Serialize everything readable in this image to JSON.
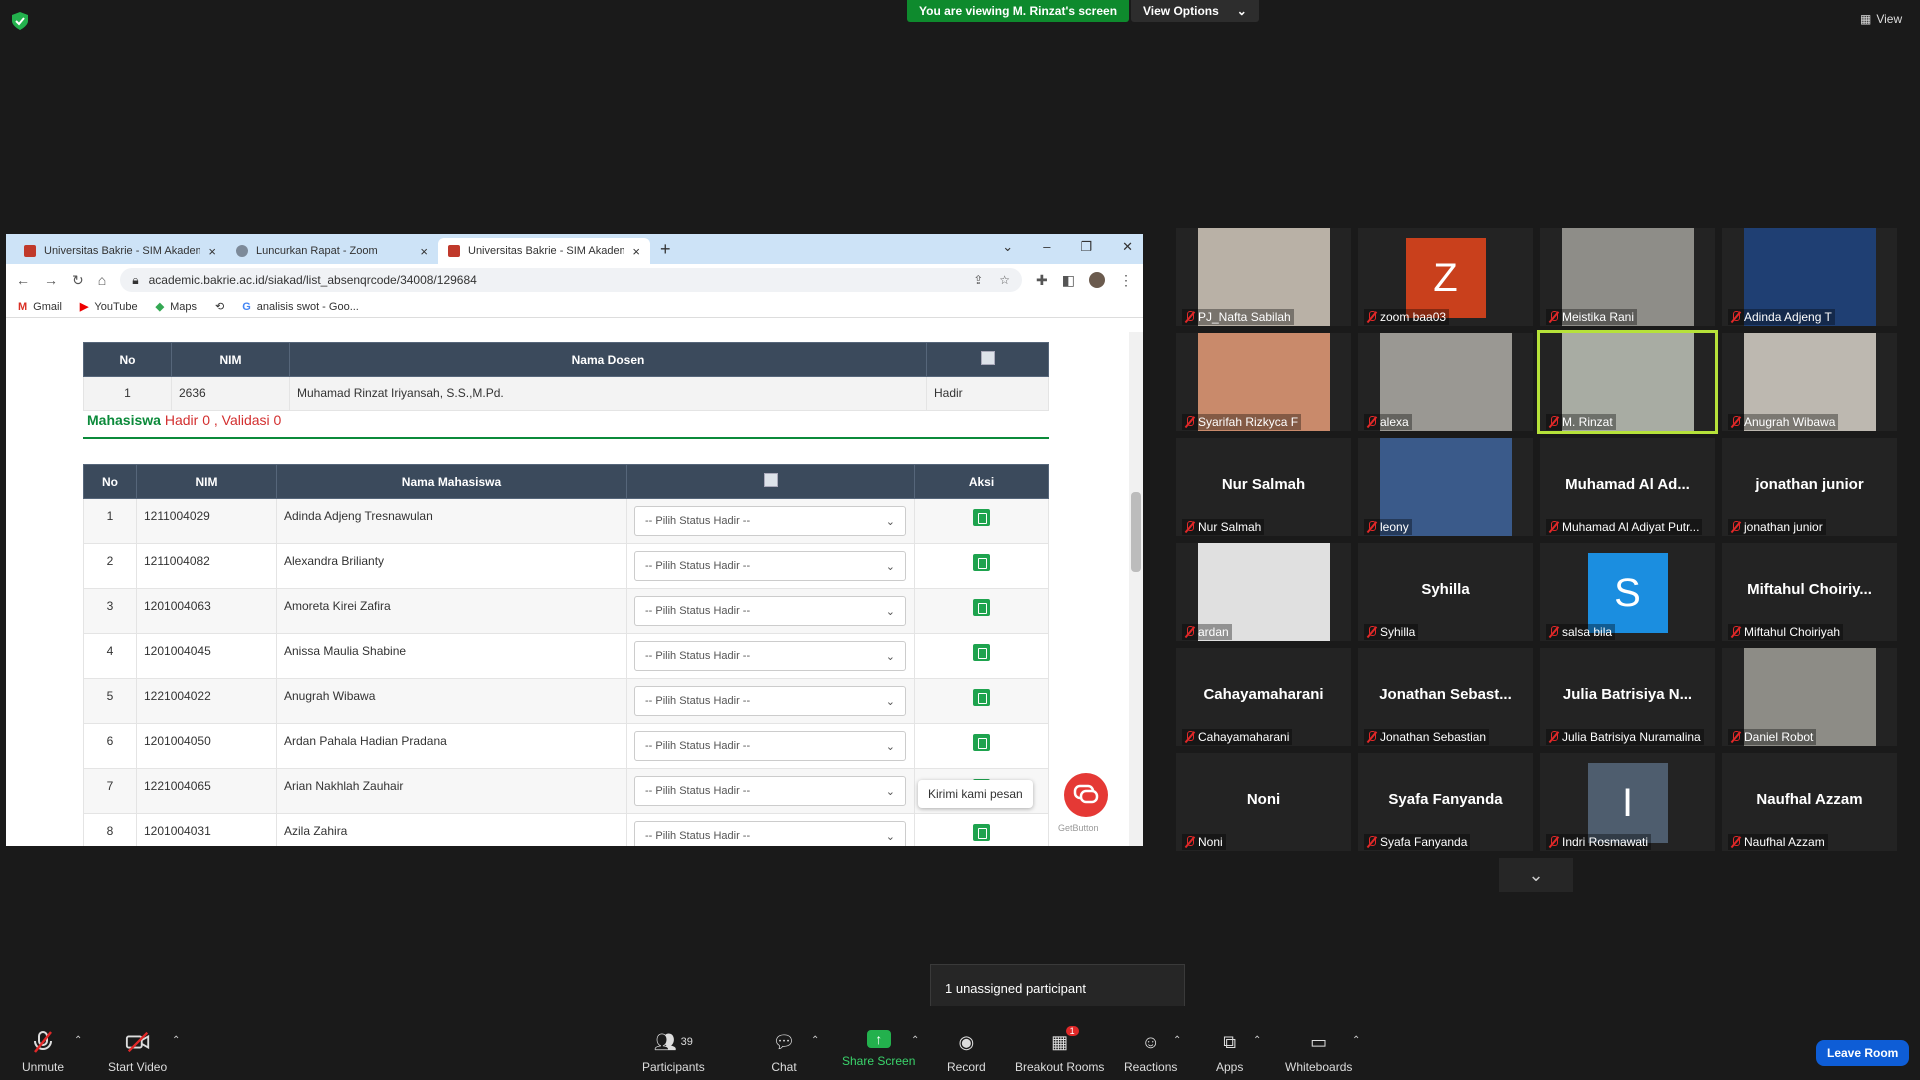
{
  "zoom_top": {
    "viewing_text": "You are viewing M. Rinzat's screen",
    "view_options": "View Options",
    "view_label": "View"
  },
  "browser": {
    "tabs": [
      {
        "title": "Universitas Bakrie - SIM Akadem",
        "active": false
      },
      {
        "title": "Luncurkan Rapat - Zoom",
        "active": false
      },
      {
        "title": "Universitas Bakrie - SIM Akadem",
        "active": true
      }
    ],
    "url": "academic.bakrie.ac.id/siakad/list_absenqrcode/34008/129684",
    "bookmarks": [
      "Gmail",
      "YouTube",
      "Maps",
      "analisis swot - Goo..."
    ]
  },
  "dosen_table": {
    "headers": [
      "No",
      "NIM",
      "Nama Dosen"
    ],
    "rows": [
      {
        "no": "1",
        "nim": "2636",
        "nama": "Muhamad Rinzat Iriyansah, S.S.,M.Pd.",
        "status": "Hadir"
      }
    ]
  },
  "summary": {
    "label": "Mahasiswa",
    "hadir_label": "Hadir",
    "hadir_count": "0",
    "sep": ",",
    "validasi_label": "Validasi",
    "validasi_count": "0"
  },
  "mahasiswa_table": {
    "headers": [
      "No",
      "NIM",
      "Nama Mahasiswa",
      "",
      "Aksi"
    ],
    "select_placeholder": "-- Pilih Status Hadir --",
    "rows": [
      {
        "no": "1",
        "nim": "1211004029",
        "nama": "Adinda Adjeng Tresnawulan"
      },
      {
        "no": "2",
        "nim": "1211004082",
        "nama": "Alexandra Brilianty"
      },
      {
        "no": "3",
        "nim": "1201004063",
        "nama": "Amoreta Kirei Zafira"
      },
      {
        "no": "4",
        "nim": "1201004045",
        "nama": "Anissa Maulia Shabine"
      },
      {
        "no": "5",
        "nim": "1221004022",
        "nama": "Anugrah Wibawa"
      },
      {
        "no": "6",
        "nim": "1201004050",
        "nama": "Ardan Pahala Hadian Pradana"
      },
      {
        "no": "7",
        "nim": "1221004065",
        "nama": "Arian Nakhlah Zauhair"
      },
      {
        "no": "8",
        "nim": "1201004031",
        "nama": "Azila Zahira"
      }
    ]
  },
  "chat_widget": {
    "tooltip": "Kirimi kami pesan",
    "brand": "GetButton"
  },
  "participants": [
    {
      "name": "PJ_Nafta Sabilah",
      "kind": "photo",
      "color": "#b9b1a6"
    },
    {
      "name": "zoom baa03",
      "kind": "letter",
      "letter": "Z",
      "color": "#c9401c"
    },
    {
      "name": "Meistika Rani",
      "kind": "photo",
      "color": "#8e8d88"
    },
    {
      "name": "Adinda Adjeng T",
      "kind": "photo",
      "color": "#1f3f73"
    },
    {
      "name": "Syarifah Rizkyca F",
      "kind": "photo",
      "color": "#c98a6b"
    },
    {
      "name": "alexa",
      "kind": "photo",
      "color": "#9a9893"
    },
    {
      "name": "M. Rinzat",
      "kind": "photo",
      "color": "#a8aca3",
      "active": true
    },
    {
      "name": "Anugrah Wibawa",
      "kind": "photo",
      "color": "#bdb8b0"
    },
    {
      "name": "Nur Salmah",
      "kind": "text",
      "big": "Nur Salmah"
    },
    {
      "name": "leony",
      "kind": "photo",
      "color": "#3a5a8a"
    },
    {
      "name": "Muhamad Al Adiyat Putr...",
      "kind": "text",
      "big": "Muhamad Al Ad..."
    },
    {
      "name": "jonathan junior",
      "kind": "text",
      "big": "jonathan junior"
    },
    {
      "name": "ardan",
      "kind": "photo",
      "color": "#e0e0e0"
    },
    {
      "name": "Syhilla",
      "kind": "text",
      "big": "Syhilla"
    },
    {
      "name": "salsa bila",
      "kind": "letter",
      "letter": "S",
      "color": "#1b8ee0"
    },
    {
      "name": "Miftahul Choiriyah",
      "kind": "text",
      "big": "Miftahul Choiriy..."
    },
    {
      "name": "Cahayamaharani",
      "kind": "text",
      "big": "Cahayamaharani"
    },
    {
      "name": "Jonathan Sebastian",
      "kind": "text",
      "big": "Jonathan Sebast..."
    },
    {
      "name": "Julia Batrisiya Nuramalina",
      "kind": "text",
      "big": "Julia Batrisiya N..."
    },
    {
      "name": "Daniel Robot",
      "kind": "photo",
      "color": "#8d8c86"
    },
    {
      "name": "Noni",
      "kind": "text",
      "big": "Noni"
    },
    {
      "name": "Syafa Fanyanda",
      "kind": "text",
      "big": "Syafa Fanyanda"
    },
    {
      "name": "Indri Rosmawati",
      "kind": "letter",
      "letter": "I",
      "color": "#4e5d6e"
    },
    {
      "name": "Naufhal Azzam",
      "kind": "text",
      "big": "Naufhal Azzam"
    }
  ],
  "breakout_notice": "1 unassigned participant",
  "toolbar": {
    "unmute": "Unmute",
    "start_video": "Start Video",
    "participants": "Participants",
    "participants_count": "39",
    "chat": "Chat",
    "share_screen": "Share Screen",
    "record": "Record",
    "breakout_rooms": "Breakout Rooms",
    "breakout_badge": "1",
    "reactions": "Reactions",
    "apps": "Apps",
    "whiteboards": "Whiteboards",
    "leave": "Leave Room"
  },
  "colors": {
    "share_green": "#0e8a2d",
    "hadir_red": "#d32f2f",
    "mahasiswa_green": "#0b8a3a",
    "header_dark": "#3b4a5c",
    "leave_blue": "#0e5dd6"
  }
}
